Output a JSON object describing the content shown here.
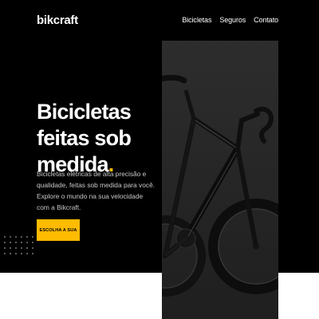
{
  "brand": {
    "logo": "bikcraft",
    "accent": "#FFBB00"
  },
  "nav": {
    "items": [
      "Bicicletas",
      "Seguros",
      "Contato"
    ]
  },
  "hero": {
    "title": "Bicicletas feitas sob medida",
    "title_dot": ".",
    "description": "Bicicletas elétricas de alta precisão e qualidade, feitas sob medida para você. Explore o mundo na sua velocidade com a Bikcraft.",
    "cta_label": "ESCOLHA A SUA"
  },
  "colors": {
    "background": "#000000",
    "text": "#FFFFFF",
    "accent": "#FFBB00",
    "muted": "#C9C9C9"
  },
  "image": {
    "icon": "bicycle-photo"
  }
}
